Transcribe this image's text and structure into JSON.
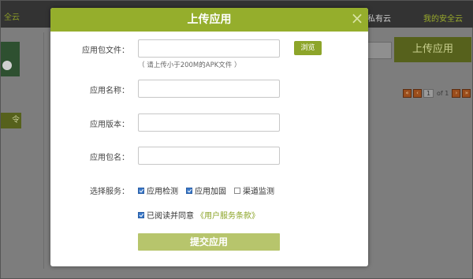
{
  "background": {
    "brand": "全云",
    "nav_private_cloud": "私有云",
    "nav_my_cloud": "我的安全云",
    "side_button": "令",
    "upload_button": "上传应用",
    "pager": {
      "current": "1",
      "of_label": "of 1"
    }
  },
  "modal": {
    "title": "上传应用",
    "close_symbol": "×",
    "file_label": "应用包文件：",
    "file_value": "",
    "browse_label": "浏览",
    "file_hint": "（ 请上传小于200M的APK文件 ）",
    "name_label": "应用名称：",
    "name_value": "",
    "version_label": "应用版本：",
    "version_value": "",
    "package_label": "应用包名：",
    "package_value": "",
    "services_label": "选择服务：",
    "services": [
      {
        "label": "应用检测",
        "checked": true
      },
      {
        "label": "应用加固",
        "checked": true
      },
      {
        "label": "渠道监测",
        "checked": false
      }
    ],
    "agree_text": "已阅读并同意",
    "terms_link": "《用户服务条款》",
    "agree_checked": true,
    "submit_label": "提交应用"
  },
  "colors": {
    "accent": "#95ae2c",
    "submit": "#b7c56c",
    "checkbox": "#3b79c9"
  }
}
